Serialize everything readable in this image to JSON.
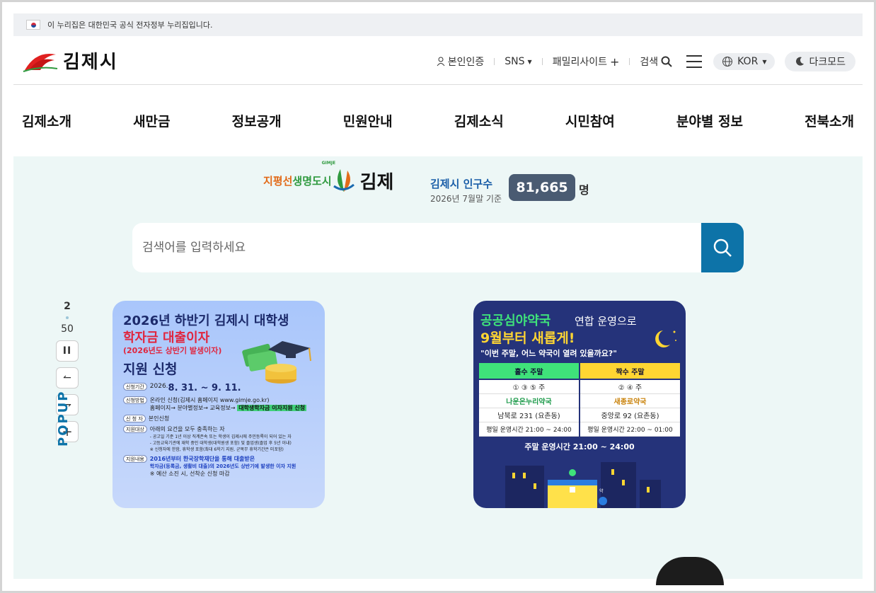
{
  "gov_bar": {
    "text": "이 누리집은 대한민국 공식 전자정부 누리집입니다."
  },
  "header": {
    "logo_text": "김제시",
    "utility": {
      "identity": "본인인증",
      "sns": "SNS",
      "family": "패밀리사이트",
      "search": "검색",
      "lang": "KOR",
      "dark": "다크모드"
    }
  },
  "gnb": [
    "김제소개",
    "새만금",
    "정보공개",
    "민원안내",
    "김제소식",
    "시민참여",
    "분야별 정보",
    "전북소개"
  ],
  "main": {
    "slogan_1": "지평선",
    "slogan_2": "생명도시",
    "slogan_small": "GIMJE",
    "slogan_3": "김제",
    "population_title": "김제시 인구수",
    "population_date": "2026년 7월말 기준",
    "population_value": "81,665",
    "population_unit": "명",
    "search_placeholder": "검색어를 입력하세요"
  },
  "popup": {
    "current": "2",
    "total": "50",
    "label": "POPUP",
    "card1": {
      "title1": "2026년 하반기 김제시 대학생",
      "title2": "학자금 대출이자",
      "title3": "(2026년도 상반기 발생이자)",
      "title4": "지원 신청",
      "rows": [
        {
          "tag": "신청기간",
          "text": "2026.",
          "big": "8. 31. ~ 9. 11."
        },
        {
          "tag": "신청방법",
          "text": "온라인 신청(김제시 홈페이지 www.gimje.go.kr)",
          "text2": "홈페이지→ 분야별정보→ 교육정보→",
          "hl": "대학생학자금 이자지원 신청"
        },
        {
          "tag": "신 청 자",
          "text": "본인신청"
        },
        {
          "tag": "지원대상",
          "text": "아래의 요건을 모두 충족하는 자",
          "sub1": "- 공고일 기준 1년 이상 직계존속 또는 학생이 김제시에 주민등록이 되어 있는 자",
          "sub2": "- 고등교육기관에 재학 중인 대학생(대학원생 포함) 및 졸업생(졸업 후 5년 이내)",
          "sub3": "※ 신청자에 한함, 휴학생 포함(최대 6학기 지원, 군복무 휴학기간은 미포함)"
        },
        {
          "tag": "지원내용",
          "blue1": "2016년부터 한국장학재단을 통해 대출받은",
          "blue2": "학자금(등록금, 생활비 대출)의 2026년도 상반기에 발생한 이자 지원",
          "sub": "※ 예산 소진 시, 선착순 신청 마감"
        }
      ]
    },
    "card2": {
      "title1": "공공심야약국",
      "title1b": "연합 운영으로",
      "title2": "9월부터 새롭게!",
      "subtitle": "\"이번 주말, 어느 약국이 열려 있을까요?\"",
      "col1_head": "홀수 주말",
      "col2_head": "짝수 주말",
      "col1": [
        "① ③ ⑤ 주",
        "나운온누리약국",
        "남북로 231 (요촌동)",
        "평일 운영시간 21:00 ~ 24:00"
      ],
      "col2": [
        "② ④ 주",
        "새종로약국",
        "중앙로 92 (요촌동)",
        "평일 운영시간 22:00 ~ 01:00"
      ],
      "weekend": "주말 운영시간 21:00 ~ 24:00",
      "pin": "약"
    }
  },
  "colors": {
    "accent": "#0d73a8",
    "population_badge": "#4a5b72",
    "main_bg": "#edf7f6"
  }
}
